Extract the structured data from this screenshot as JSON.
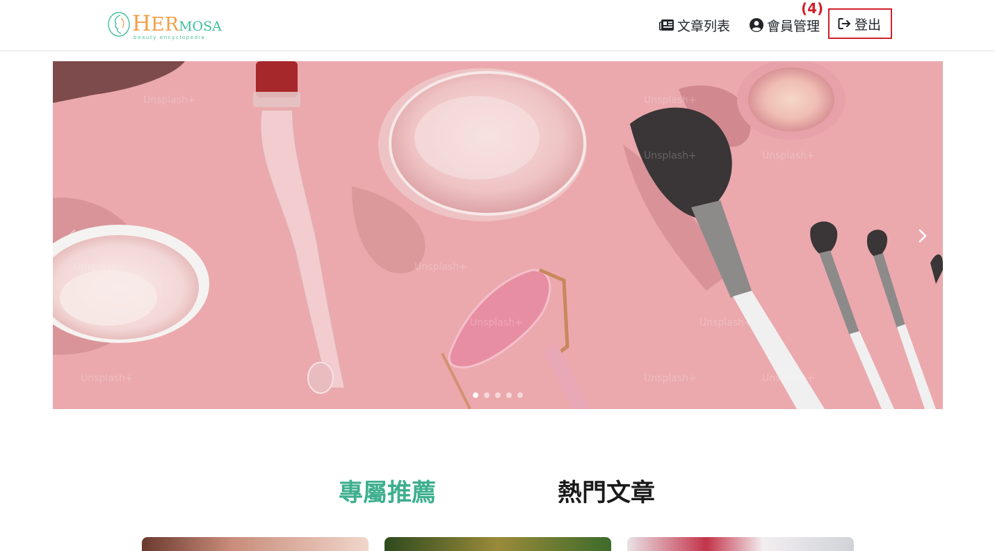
{
  "header": {
    "brand": {
      "name_first": "H",
      "name_mid": "ER",
      "name_last": "MOSA",
      "tagline": "beauty encyclopedia"
    },
    "nav": {
      "articles_label": "文章列表",
      "members_label": "會員管理",
      "logout_label": "登出"
    },
    "annotation_label": "(4)"
  },
  "carousel": {
    "slide_count": 5,
    "active_index": 0
  },
  "sections": {
    "tabs": [
      {
        "label": "專屬推薦",
        "active": true
      },
      {
        "label": "熱門文章",
        "active": false
      }
    ]
  },
  "colors": {
    "accent_green": "#3eaf8f",
    "brand_orange": "#f0a04b",
    "highlight_red": "#d0202a",
    "hero_pink": "#eba9ad"
  }
}
